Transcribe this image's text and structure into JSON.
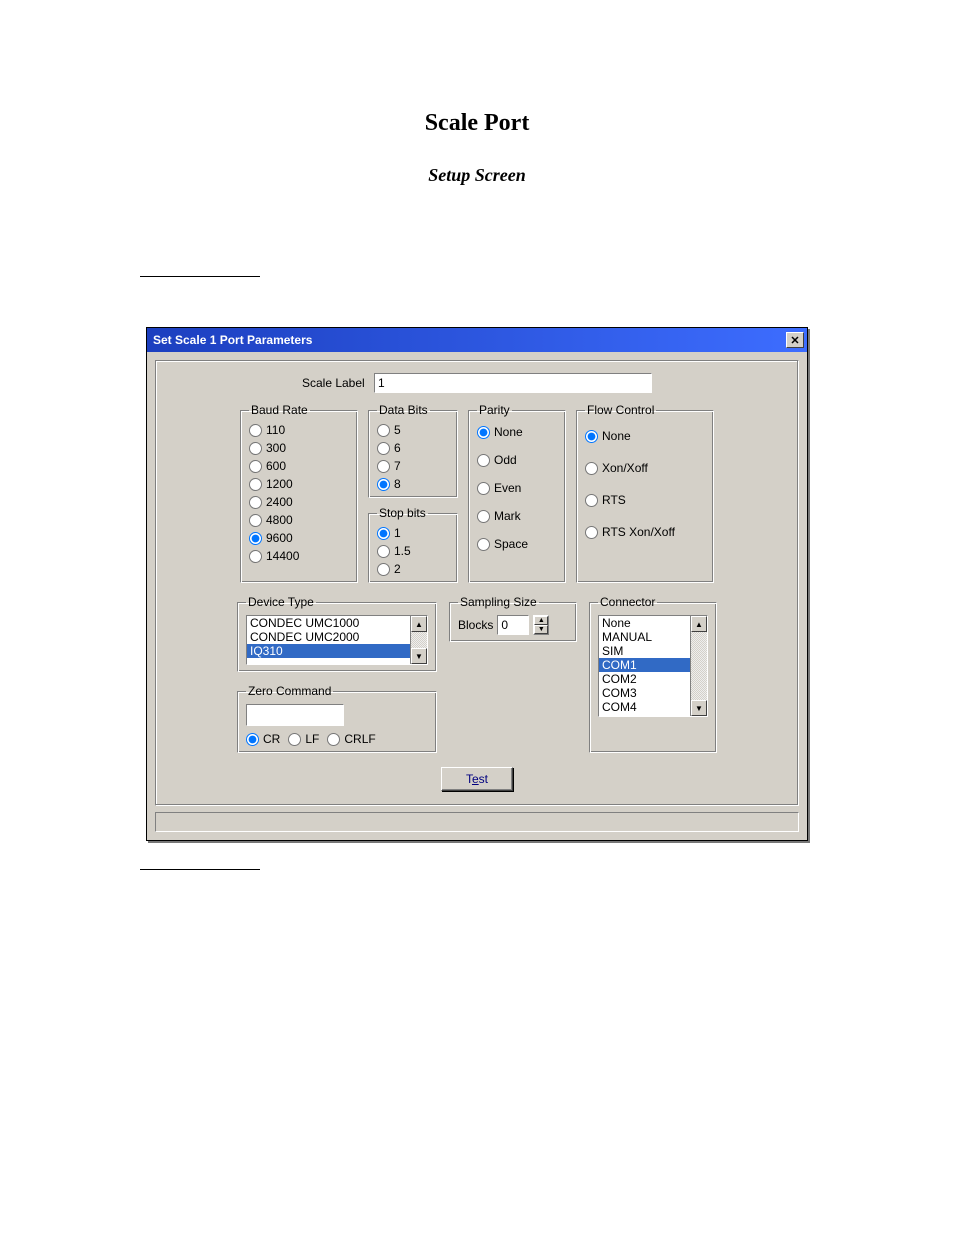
{
  "page": {
    "title": "Scale Port",
    "subtitle": "Setup Screen"
  },
  "dialog": {
    "title": "Set Scale 1 Port Parameters",
    "scale_label_label": "Scale Label",
    "scale_label_value": "1",
    "test_prefix": "T",
    "test_underline": "e",
    "test_suffix": "st"
  },
  "baud": {
    "legend": "Baud Rate",
    "options": [
      "110",
      "300",
      "600",
      "1200",
      "2400",
      "4800",
      "9600",
      "14400"
    ],
    "selected": "9600"
  },
  "databits": {
    "legend": "Data Bits",
    "options": [
      "5",
      "6",
      "7",
      "8"
    ],
    "selected": "8"
  },
  "stopbits": {
    "legend": "Stop bits",
    "options": [
      "1",
      "1.5",
      "2"
    ],
    "selected": "1"
  },
  "parity": {
    "legend": "Parity",
    "options": [
      "None",
      "Odd",
      "Even",
      "Mark",
      "Space"
    ],
    "selected": "None"
  },
  "flow": {
    "legend": "Flow Control",
    "options": [
      "None",
      "Xon/Xoff",
      "RTS",
      "RTS Xon/Xoff"
    ],
    "selected": "None"
  },
  "device": {
    "legend": "Device Type",
    "items": [
      "CONDEC UMC1000",
      "CONDEC UMC2000",
      "IQ310"
    ],
    "selected": "IQ310"
  },
  "zero": {
    "legend": "Zero Command",
    "value": "",
    "options": [
      "CR",
      "LF",
      "CRLF"
    ],
    "selected": "CR"
  },
  "sampling": {
    "legend": "Sampling Size",
    "blocks_label": "Blocks",
    "blocks_value": "0"
  },
  "connector": {
    "legend": "Connector",
    "items": [
      "None",
      "MANUAL",
      "SIM",
      "COM1",
      "COM2",
      "COM3",
      "COM4"
    ],
    "selected": "COM1"
  }
}
